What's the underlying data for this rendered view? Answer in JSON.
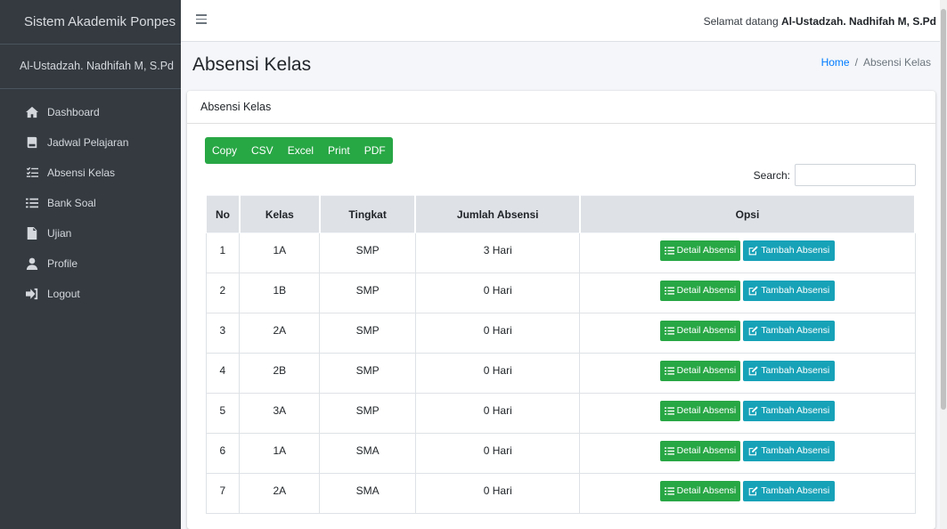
{
  "sidebar": {
    "brand": "Sistem Akademik Ponpes",
    "user": "Al-Ustadzah. Nadhifah M, S.Pd",
    "items": [
      {
        "label": "Dashboard",
        "icon": "home-icon"
      },
      {
        "label": "Jadwal Pelajaran",
        "icon": "book-icon"
      },
      {
        "label": "Absensi Kelas",
        "icon": "checklist-icon"
      },
      {
        "label": "Bank Soal",
        "icon": "list-icon"
      },
      {
        "label": "Ujian",
        "icon": "file-icon"
      },
      {
        "label": "Profile",
        "icon": "user-icon"
      },
      {
        "label": "Logout",
        "icon": "sign-out-icon"
      }
    ]
  },
  "topbar": {
    "welcome_prefix": "Selamat datang",
    "welcome_name": "Al-Ustadzah. Nadhifah M, S.Pd"
  },
  "header": {
    "title": "Absensi Kelas",
    "breadcrumb_home": "Home",
    "breadcrumb_sep": "/",
    "breadcrumb_current": "Absensi Kelas"
  },
  "card": {
    "title": "Absensi Kelas",
    "export_buttons": [
      "Copy",
      "CSV",
      "Excel",
      "Print",
      "PDF"
    ],
    "search_label": "Search:",
    "search_value": ""
  },
  "table": {
    "headers": [
      "No",
      "Kelas",
      "Tingkat",
      "Jumlah Absensi",
      "Opsi"
    ],
    "detail_label": "Detail Absensi",
    "tambah_label": "Tambah Absensi",
    "rows": [
      {
        "no": "1",
        "kelas": "1A",
        "tingkat": "SMP",
        "jumlah": "3 Hari"
      },
      {
        "no": "2",
        "kelas": "1B",
        "tingkat": "SMP",
        "jumlah": "0 Hari"
      },
      {
        "no": "3",
        "kelas": "2A",
        "tingkat": "SMP",
        "jumlah": "0 Hari"
      },
      {
        "no": "4",
        "kelas": "2B",
        "tingkat": "SMP",
        "jumlah": "0 Hari"
      },
      {
        "no": "5",
        "kelas": "3A",
        "tingkat": "SMP",
        "jumlah": "0 Hari"
      },
      {
        "no": "6",
        "kelas": "1A",
        "tingkat": "SMA",
        "jumlah": "0 Hari"
      },
      {
        "no": "7",
        "kelas": "2A",
        "tingkat": "SMA",
        "jumlah": "0 Hari"
      }
    ]
  },
  "colors": {
    "sidebar_bg": "#343a40",
    "success": "#28a745",
    "info": "#17a2b8",
    "link": "#007bff"
  }
}
